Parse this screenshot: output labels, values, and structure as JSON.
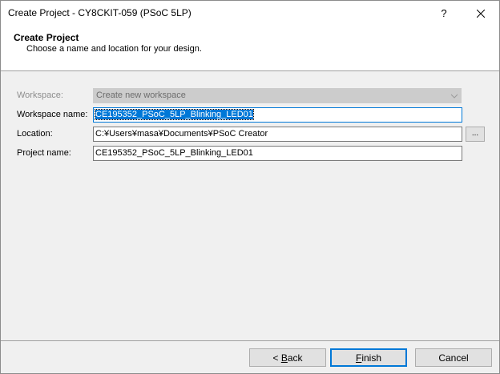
{
  "window": {
    "title": "Create Project - CY8CKIT-059 (PSoC 5LP)",
    "help_label": "?",
    "close_icon": "close-icon"
  },
  "header": {
    "title": "Create Project",
    "subtitle": "Choose a name and location for your design."
  },
  "form": {
    "workspace": {
      "label": "Workspace:",
      "value": "Create new workspace",
      "enabled": false
    },
    "workspace_name": {
      "label": "Workspace name:",
      "value": "CE195352_PSoC_5LP_Blinking_LED01",
      "selected": true
    },
    "location": {
      "label": "Location:",
      "value": "C:¥Users¥masa¥Documents¥PSoC Creator",
      "browse_label": "..."
    },
    "project_name": {
      "label": "Project name:",
      "value": "CE195352_PSoC_5LP_Blinking_LED01"
    }
  },
  "buttons": {
    "back_prefix": "< ",
    "back_accel": "B",
    "back_rest": "ack",
    "finish_accel": "F",
    "finish_rest": "inish",
    "cancel": "Cancel"
  },
  "colors": {
    "accent": "#0078d7",
    "dialog_bg": "#f0f0f0",
    "disabled_combo_bg": "#cccccc"
  }
}
